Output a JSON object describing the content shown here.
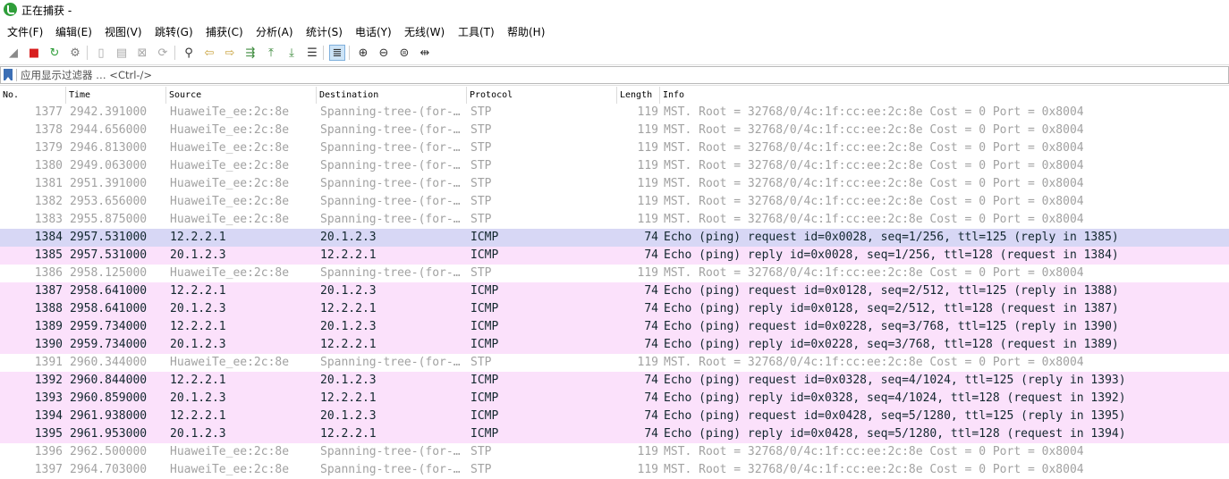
{
  "window": {
    "title": "正在捕获 -"
  },
  "menu": [
    "文件(F)",
    "编辑(E)",
    "视图(V)",
    "跳转(G)",
    "捕获(C)",
    "分析(A)",
    "统计(S)",
    "电话(Y)",
    "无线(W)",
    "工具(T)",
    "帮助(H)"
  ],
  "toolbar": {
    "buttons": [
      {
        "name": "start-capture-icon",
        "glyph": "◢",
        "color": "#8a8a8a"
      },
      {
        "name": "stop-capture-icon",
        "glyph": "■",
        "color": "#d81e1e"
      },
      {
        "name": "restart-capture-icon",
        "glyph": "↻",
        "color": "#2f9e3a"
      },
      {
        "name": "capture-options-icon",
        "glyph": "⚙",
        "color": "#7a7a7a"
      },
      {
        "name": "open-file-icon",
        "glyph": "▯",
        "color": "#a8a8a8"
      },
      {
        "name": "save-file-icon",
        "glyph": "▤",
        "color": "#a8a8a8"
      },
      {
        "name": "close-file-icon",
        "glyph": "⊠",
        "color": "#a8a8a8"
      },
      {
        "name": "reload-file-icon",
        "glyph": "⟳",
        "color": "#a8a8a8"
      },
      {
        "name": "find-packet-icon",
        "glyph": "⚲",
        "color": "#333333"
      },
      {
        "name": "go-back-icon",
        "glyph": "⇦",
        "color": "#c8a23c"
      },
      {
        "name": "go-forward-icon",
        "glyph": "⇨",
        "color": "#c8a23c"
      },
      {
        "name": "go-to-packet-icon",
        "glyph": "⇶",
        "color": "#3c8a3c"
      },
      {
        "name": "first-packet-icon",
        "glyph": "⤒",
        "color": "#3c8a3c"
      },
      {
        "name": "last-packet-icon",
        "glyph": "⤓",
        "color": "#3c8a3c"
      },
      {
        "name": "auto-scroll-icon",
        "glyph": "☰",
        "color": "#333333"
      },
      {
        "name": "colorize-icon",
        "glyph": "≣",
        "color": "#333333"
      },
      {
        "name": "zoom-in-icon",
        "glyph": "⊕",
        "color": "#333333"
      },
      {
        "name": "zoom-out-icon",
        "glyph": "⊖",
        "color": "#333333"
      },
      {
        "name": "zoom-normal-icon",
        "glyph": "⊜",
        "color": "#333333"
      },
      {
        "name": "resize-columns-icon",
        "glyph": "⇹",
        "color": "#333333"
      }
    ]
  },
  "filter": {
    "placeholder": "应用显示过滤器 … <Ctrl-/>"
  },
  "columns": [
    "No.",
    "Time",
    "Source",
    "Destination",
    "Protocol",
    "Length",
    "Info"
  ],
  "colors": {
    "stp_bg": "#ffffff",
    "stp_fg": "#a2a2a2",
    "icmp_bg": "#fbe1fb",
    "icmp_fg": "#12272e",
    "selected_bg": "#d7d7f5"
  },
  "packets": [
    {
      "no": "1377",
      "time": "2942.391000",
      "src": "HuaweiTe_ee:2c:8e",
      "dst": "Spanning-tree-(for-…",
      "proto": "STP",
      "len": "119",
      "info": "MST. Root = 32768/0/4c:1f:cc:ee:2c:8e  Cost = 0  Port = 0x8004",
      "kind": "stp"
    },
    {
      "no": "1378",
      "time": "2944.656000",
      "src": "HuaweiTe_ee:2c:8e",
      "dst": "Spanning-tree-(for-…",
      "proto": "STP",
      "len": "119",
      "info": "MST. Root = 32768/0/4c:1f:cc:ee:2c:8e  Cost = 0  Port = 0x8004",
      "kind": "stp"
    },
    {
      "no": "1379",
      "time": "2946.813000",
      "src": "HuaweiTe_ee:2c:8e",
      "dst": "Spanning-tree-(for-…",
      "proto": "STP",
      "len": "119",
      "info": "MST. Root = 32768/0/4c:1f:cc:ee:2c:8e  Cost = 0  Port = 0x8004",
      "kind": "stp"
    },
    {
      "no": "1380",
      "time": "2949.063000",
      "src": "HuaweiTe_ee:2c:8e",
      "dst": "Spanning-tree-(for-…",
      "proto": "STP",
      "len": "119",
      "info": "MST. Root = 32768/0/4c:1f:cc:ee:2c:8e  Cost = 0  Port = 0x8004",
      "kind": "stp"
    },
    {
      "no": "1381",
      "time": "2951.391000",
      "src": "HuaweiTe_ee:2c:8e",
      "dst": "Spanning-tree-(for-…",
      "proto": "STP",
      "len": "119",
      "info": "MST. Root = 32768/0/4c:1f:cc:ee:2c:8e  Cost = 0  Port = 0x8004",
      "kind": "stp"
    },
    {
      "no": "1382",
      "time": "2953.656000",
      "src": "HuaweiTe_ee:2c:8e",
      "dst": "Spanning-tree-(for-…",
      "proto": "STP",
      "len": "119",
      "info": "MST. Root = 32768/0/4c:1f:cc:ee:2c:8e  Cost = 0  Port = 0x8004",
      "kind": "stp"
    },
    {
      "no": "1383",
      "time": "2955.875000",
      "src": "HuaweiTe_ee:2c:8e",
      "dst": "Spanning-tree-(for-…",
      "proto": "STP",
      "len": "119",
      "info": "MST. Root = 32768/0/4c:1f:cc:ee:2c:8e  Cost = 0  Port = 0x8004",
      "kind": "stp"
    },
    {
      "no": "1384",
      "time": "2957.531000",
      "src": "12.2.2.1",
      "dst": "20.1.2.3",
      "proto": "ICMP",
      "len": "74",
      "info": "Echo (ping) request  id=0x0028, seq=1/256, ttl=125 (reply in 1385)",
      "kind": "icmp",
      "selected": true
    },
    {
      "no": "1385",
      "time": "2957.531000",
      "src": "20.1.2.3",
      "dst": "12.2.2.1",
      "proto": "ICMP",
      "len": "74",
      "info": "Echo (ping) reply    id=0x0028, seq=1/256, ttl=128 (request in 1384)",
      "kind": "icmp"
    },
    {
      "no": "1386",
      "time": "2958.125000",
      "src": "HuaweiTe_ee:2c:8e",
      "dst": "Spanning-tree-(for-…",
      "proto": "STP",
      "len": "119",
      "info": "MST. Root = 32768/0/4c:1f:cc:ee:2c:8e  Cost = 0  Port = 0x8004",
      "kind": "stp"
    },
    {
      "no": "1387",
      "time": "2958.641000",
      "src": "12.2.2.1",
      "dst": "20.1.2.3",
      "proto": "ICMP",
      "len": "74",
      "info": "Echo (ping) request  id=0x0128, seq=2/512, ttl=125 (reply in 1388)",
      "kind": "icmp"
    },
    {
      "no": "1388",
      "time": "2958.641000",
      "src": "20.1.2.3",
      "dst": "12.2.2.1",
      "proto": "ICMP",
      "len": "74",
      "info": "Echo (ping) reply    id=0x0128, seq=2/512, ttl=128 (request in 1387)",
      "kind": "icmp"
    },
    {
      "no": "1389",
      "time": "2959.734000",
      "src": "12.2.2.1",
      "dst": "20.1.2.3",
      "proto": "ICMP",
      "len": "74",
      "info": "Echo (ping) request  id=0x0228, seq=3/768, ttl=125 (reply in 1390)",
      "kind": "icmp"
    },
    {
      "no": "1390",
      "time": "2959.734000",
      "src": "20.1.2.3",
      "dst": "12.2.2.1",
      "proto": "ICMP",
      "len": "74",
      "info": "Echo (ping) reply    id=0x0228, seq=3/768, ttl=128 (request in 1389)",
      "kind": "icmp"
    },
    {
      "no": "1391",
      "time": "2960.344000",
      "src": "HuaweiTe_ee:2c:8e",
      "dst": "Spanning-tree-(for-…",
      "proto": "STP",
      "len": "119",
      "info": "MST. Root = 32768/0/4c:1f:cc:ee:2c:8e  Cost = 0  Port = 0x8004",
      "kind": "stp"
    },
    {
      "no": "1392",
      "time": "2960.844000",
      "src": "12.2.2.1",
      "dst": "20.1.2.3",
      "proto": "ICMP",
      "len": "74",
      "info": "Echo (ping) request  id=0x0328, seq=4/1024, ttl=125 (reply in 1393)",
      "kind": "icmp"
    },
    {
      "no": "1393",
      "time": "2960.859000",
      "src": "20.1.2.3",
      "dst": "12.2.2.1",
      "proto": "ICMP",
      "len": "74",
      "info": "Echo (ping) reply    id=0x0328, seq=4/1024, ttl=128 (request in 1392)",
      "kind": "icmp"
    },
    {
      "no": "1394",
      "time": "2961.938000",
      "src": "12.2.2.1",
      "dst": "20.1.2.3",
      "proto": "ICMP",
      "len": "74",
      "info": "Echo (ping) request  id=0x0428, seq=5/1280, ttl=125 (reply in 1395)",
      "kind": "icmp"
    },
    {
      "no": "1395",
      "time": "2961.953000",
      "src": "20.1.2.3",
      "dst": "12.2.2.1",
      "proto": "ICMP",
      "len": "74",
      "info": "Echo (ping) reply    id=0x0428, seq=5/1280, ttl=128 (request in 1394)",
      "kind": "icmp"
    },
    {
      "no": "1396",
      "time": "2962.500000",
      "src": "HuaweiTe_ee:2c:8e",
      "dst": "Spanning-tree-(for-…",
      "proto": "STP",
      "len": "119",
      "info": "MST. Root = 32768/0/4c:1f:cc:ee:2c:8e  Cost = 0  Port = 0x8004",
      "kind": "stp"
    },
    {
      "no": "1397",
      "time": "2964.703000",
      "src": "HuaweiTe_ee:2c:8e",
      "dst": "Spanning-tree-(for-…",
      "proto": "STP",
      "len": "119",
      "info": "MST. Root = 32768/0/4c:1f:cc:ee:2c:8e  Cost = 0  Port = 0x8004",
      "kind": "stp"
    }
  ]
}
